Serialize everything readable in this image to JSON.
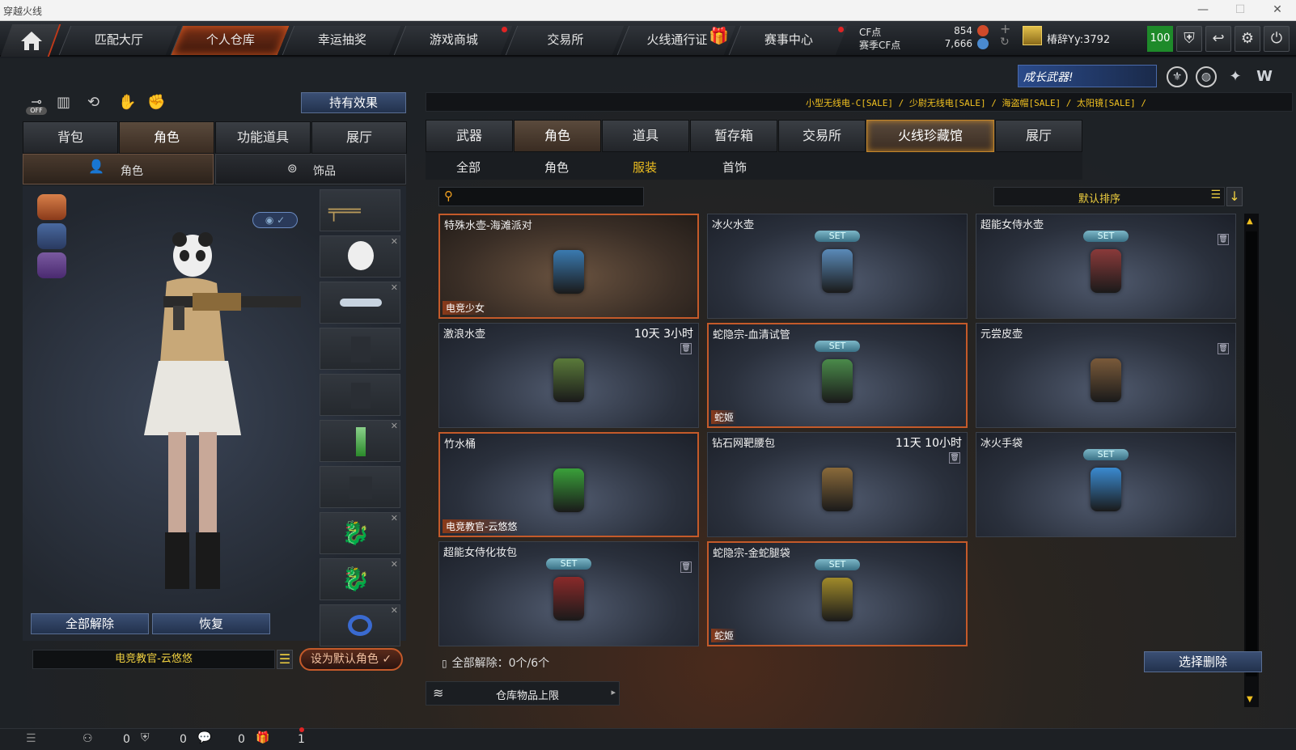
{
  "window": {
    "title": "穿越火线"
  },
  "nav": {
    "tabs": [
      {
        "label": "匹配大厅"
      },
      {
        "label": "个人仓库"
      },
      {
        "label": "幸运抽奖"
      },
      {
        "label": "游戏商城"
      },
      {
        "label": "交易所"
      },
      {
        "label": "火线通行证"
      },
      {
        "label": "赛事中心"
      }
    ],
    "cf_label": "CF点",
    "cf_value": "854",
    "season_label": "赛季CF点",
    "season_value": "7,666",
    "username": "椿辞Yy:3792",
    "level": "100"
  },
  "banner": {
    "promo": "成长武器!",
    "marquee": "小型无线电-C[SALE] / 少尉无线电[SALE] / 海盗帽[SALE] / 太阳镜[SALE] /"
  },
  "left": {
    "effects_btn": "持有效果",
    "off_label": "OFF",
    "tabs": [
      "背包",
      "角色",
      "功能道具",
      "展厅"
    ],
    "subtabs": [
      "角色",
      "饰品"
    ],
    "clear_all": "全部解除",
    "restore": "恢复",
    "character_name": "电竞教官-云悠悠",
    "set_default": "设为默认角色"
  },
  "right": {
    "tabs": [
      "武器",
      "角色",
      "道具",
      "暂存箱",
      "交易所",
      "火线珍藏馆",
      "展厅"
    ],
    "subtabs": [
      "全部",
      "角色",
      "服装",
      "首饰"
    ],
    "search_placeholder": "",
    "sort_label": "默认排序",
    "set_badge": "SET",
    "items": [
      {
        "name": "特殊水壶-海滩派对",
        "tag": "电竞少女",
        "time": "",
        "set": false,
        "trash": false
      },
      {
        "name": "冰火水壶",
        "tag": "",
        "time": "",
        "set": true,
        "trash": false
      },
      {
        "name": "超能女侍水壶",
        "tag": "",
        "time": "",
        "set": true,
        "trash": true
      },
      {
        "name": "激浪水壶",
        "tag": "",
        "time": "10天 3小时",
        "set": false,
        "trash": true
      },
      {
        "name": "蛇隐宗-血清试管",
        "tag": "蛇姬",
        "time": "",
        "set": true,
        "trash": false
      },
      {
        "name": "元尝皮壶",
        "tag": "",
        "time": "",
        "set": false,
        "trash": true
      },
      {
        "name": "竹水桶",
        "tag": "电竞教官-云悠悠",
        "time": "",
        "set": false,
        "trash": false
      },
      {
        "name": "钻石网靶腰包",
        "tag": "",
        "time": "11天 10小时",
        "set": false,
        "trash": true
      },
      {
        "name": "冰火手袋",
        "tag": "",
        "time": "",
        "set": true,
        "trash": false
      },
      {
        "name": "超能女侍化妆包",
        "tag": "",
        "time": "",
        "set": true,
        "trash": true
      },
      {
        "name": "蛇隐宗-金蛇腿袋",
        "tag": "蛇姬",
        "time": "",
        "set": true,
        "trash": false
      }
    ],
    "clear_status": "全部解除：0个/6个",
    "select_delete": "选择删除",
    "capacity": "仓库物品上限"
  },
  "bottom": {
    "c1": "0",
    "c2": "0",
    "c3": "0",
    "c4": "1"
  },
  "colors": {
    "accent": "#c45a2a",
    "set_badge": "#5aa0b4",
    "gold": "#f0c020"
  }
}
